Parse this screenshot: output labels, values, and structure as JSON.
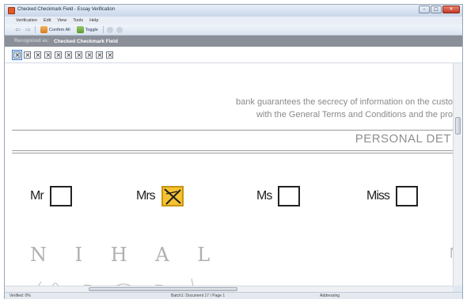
{
  "window": {
    "title": "Checked Checkmark Field - Essay Verification",
    "minimize": "–",
    "maximize": "□",
    "close": "✕"
  },
  "menu": [
    "Verification",
    "Edit",
    "View",
    "Tools",
    "Help"
  ],
  "toolbar": {
    "back": "⇦",
    "forward": "⇨",
    "confirm_all": "Confirm All",
    "toggle": "Toggle"
  },
  "recognized": {
    "label": "Recognized as:",
    "value": "Checked Checkmark Field"
  },
  "document": {
    "line1": "bank guarantees the secrecy of information on the custo",
    "line2": "with the General Terms and Conditions and the pro",
    "section_title": "PERSONAL DET",
    "options": [
      {
        "label": "Mr",
        "checked": false
      },
      {
        "label": "Mrs",
        "checked": true
      },
      {
        "label": "Ms",
        "checked": false
      },
      {
        "label": "Miss",
        "checked": false
      }
    ],
    "handwritten_name": "N I H A L",
    "right_letter": "N"
  },
  "status": {
    "left": "Verified: 0%",
    "middle": "Batch1: Document 17 / Page 1",
    "right": "Addressing"
  }
}
